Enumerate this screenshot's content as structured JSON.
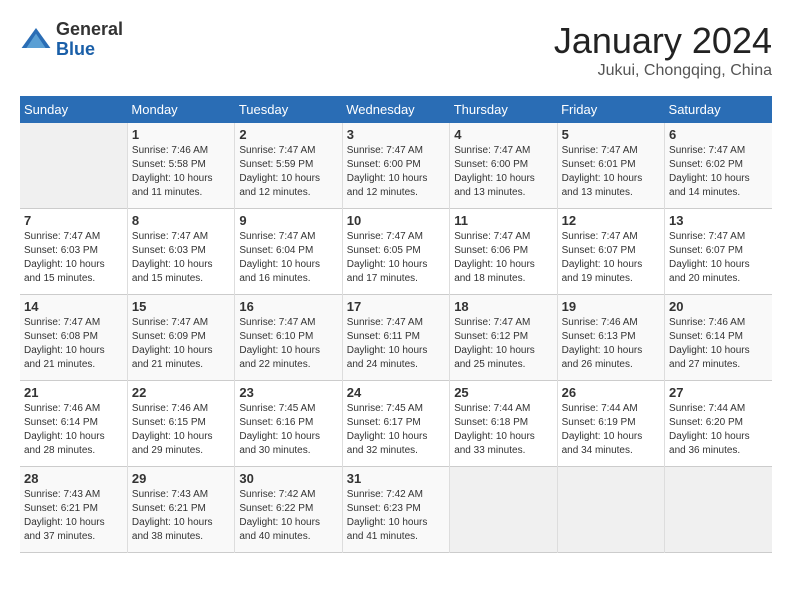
{
  "logo": {
    "general": "General",
    "blue": "Blue"
  },
  "title": "January 2024",
  "location": "Jukui, Chongqing, China",
  "days_of_week": [
    "Sunday",
    "Monday",
    "Tuesday",
    "Wednesday",
    "Thursday",
    "Friday",
    "Saturday"
  ],
  "weeks": [
    [
      {
        "day": "",
        "sunrise": "",
        "sunset": "",
        "daylight": ""
      },
      {
        "day": "1",
        "sunrise": "Sunrise: 7:46 AM",
        "sunset": "Sunset: 5:58 PM",
        "daylight": "Daylight: 10 hours and 11 minutes."
      },
      {
        "day": "2",
        "sunrise": "Sunrise: 7:47 AM",
        "sunset": "Sunset: 5:59 PM",
        "daylight": "Daylight: 10 hours and 12 minutes."
      },
      {
        "day": "3",
        "sunrise": "Sunrise: 7:47 AM",
        "sunset": "Sunset: 6:00 PM",
        "daylight": "Daylight: 10 hours and 12 minutes."
      },
      {
        "day": "4",
        "sunrise": "Sunrise: 7:47 AM",
        "sunset": "Sunset: 6:00 PM",
        "daylight": "Daylight: 10 hours and 13 minutes."
      },
      {
        "day": "5",
        "sunrise": "Sunrise: 7:47 AM",
        "sunset": "Sunset: 6:01 PM",
        "daylight": "Daylight: 10 hours and 13 minutes."
      },
      {
        "day": "6",
        "sunrise": "Sunrise: 7:47 AM",
        "sunset": "Sunset: 6:02 PM",
        "daylight": "Daylight: 10 hours and 14 minutes."
      }
    ],
    [
      {
        "day": "7",
        "sunrise": "Sunrise: 7:47 AM",
        "sunset": "Sunset: 6:03 PM",
        "daylight": "Daylight: 10 hours and 15 minutes."
      },
      {
        "day": "8",
        "sunrise": "Sunrise: 7:47 AM",
        "sunset": "Sunset: 6:03 PM",
        "daylight": "Daylight: 10 hours and 15 minutes."
      },
      {
        "day": "9",
        "sunrise": "Sunrise: 7:47 AM",
        "sunset": "Sunset: 6:04 PM",
        "daylight": "Daylight: 10 hours and 16 minutes."
      },
      {
        "day": "10",
        "sunrise": "Sunrise: 7:47 AM",
        "sunset": "Sunset: 6:05 PM",
        "daylight": "Daylight: 10 hours and 17 minutes."
      },
      {
        "day": "11",
        "sunrise": "Sunrise: 7:47 AM",
        "sunset": "Sunset: 6:06 PM",
        "daylight": "Daylight: 10 hours and 18 minutes."
      },
      {
        "day": "12",
        "sunrise": "Sunrise: 7:47 AM",
        "sunset": "Sunset: 6:07 PM",
        "daylight": "Daylight: 10 hours and 19 minutes."
      },
      {
        "day": "13",
        "sunrise": "Sunrise: 7:47 AM",
        "sunset": "Sunset: 6:07 PM",
        "daylight": "Daylight: 10 hours and 20 minutes."
      }
    ],
    [
      {
        "day": "14",
        "sunrise": "Sunrise: 7:47 AM",
        "sunset": "Sunset: 6:08 PM",
        "daylight": "Daylight: 10 hours and 21 minutes."
      },
      {
        "day": "15",
        "sunrise": "Sunrise: 7:47 AM",
        "sunset": "Sunset: 6:09 PM",
        "daylight": "Daylight: 10 hours and 21 minutes."
      },
      {
        "day": "16",
        "sunrise": "Sunrise: 7:47 AM",
        "sunset": "Sunset: 6:10 PM",
        "daylight": "Daylight: 10 hours and 22 minutes."
      },
      {
        "day": "17",
        "sunrise": "Sunrise: 7:47 AM",
        "sunset": "Sunset: 6:11 PM",
        "daylight": "Daylight: 10 hours and 24 minutes."
      },
      {
        "day": "18",
        "sunrise": "Sunrise: 7:47 AM",
        "sunset": "Sunset: 6:12 PM",
        "daylight": "Daylight: 10 hours and 25 minutes."
      },
      {
        "day": "19",
        "sunrise": "Sunrise: 7:46 AM",
        "sunset": "Sunset: 6:13 PM",
        "daylight": "Daylight: 10 hours and 26 minutes."
      },
      {
        "day": "20",
        "sunrise": "Sunrise: 7:46 AM",
        "sunset": "Sunset: 6:14 PM",
        "daylight": "Daylight: 10 hours and 27 minutes."
      }
    ],
    [
      {
        "day": "21",
        "sunrise": "Sunrise: 7:46 AM",
        "sunset": "Sunset: 6:14 PM",
        "daylight": "Daylight: 10 hours and 28 minutes."
      },
      {
        "day": "22",
        "sunrise": "Sunrise: 7:46 AM",
        "sunset": "Sunset: 6:15 PM",
        "daylight": "Daylight: 10 hours and 29 minutes."
      },
      {
        "day": "23",
        "sunrise": "Sunrise: 7:45 AM",
        "sunset": "Sunset: 6:16 PM",
        "daylight": "Daylight: 10 hours and 30 minutes."
      },
      {
        "day": "24",
        "sunrise": "Sunrise: 7:45 AM",
        "sunset": "Sunset: 6:17 PM",
        "daylight": "Daylight: 10 hours and 32 minutes."
      },
      {
        "day": "25",
        "sunrise": "Sunrise: 7:44 AM",
        "sunset": "Sunset: 6:18 PM",
        "daylight": "Daylight: 10 hours and 33 minutes."
      },
      {
        "day": "26",
        "sunrise": "Sunrise: 7:44 AM",
        "sunset": "Sunset: 6:19 PM",
        "daylight": "Daylight: 10 hours and 34 minutes."
      },
      {
        "day": "27",
        "sunrise": "Sunrise: 7:44 AM",
        "sunset": "Sunset: 6:20 PM",
        "daylight": "Daylight: 10 hours and 36 minutes."
      }
    ],
    [
      {
        "day": "28",
        "sunrise": "Sunrise: 7:43 AM",
        "sunset": "Sunset: 6:21 PM",
        "daylight": "Daylight: 10 hours and 37 minutes."
      },
      {
        "day": "29",
        "sunrise": "Sunrise: 7:43 AM",
        "sunset": "Sunset: 6:21 PM",
        "daylight": "Daylight: 10 hours and 38 minutes."
      },
      {
        "day": "30",
        "sunrise": "Sunrise: 7:42 AM",
        "sunset": "Sunset: 6:22 PM",
        "daylight": "Daylight: 10 hours and 40 minutes."
      },
      {
        "day": "31",
        "sunrise": "Sunrise: 7:42 AM",
        "sunset": "Sunset: 6:23 PM",
        "daylight": "Daylight: 10 hours and 41 minutes."
      },
      {
        "day": "",
        "sunrise": "",
        "sunset": "",
        "daylight": ""
      },
      {
        "day": "",
        "sunrise": "",
        "sunset": "",
        "daylight": ""
      },
      {
        "day": "",
        "sunrise": "",
        "sunset": "",
        "daylight": ""
      }
    ]
  ]
}
